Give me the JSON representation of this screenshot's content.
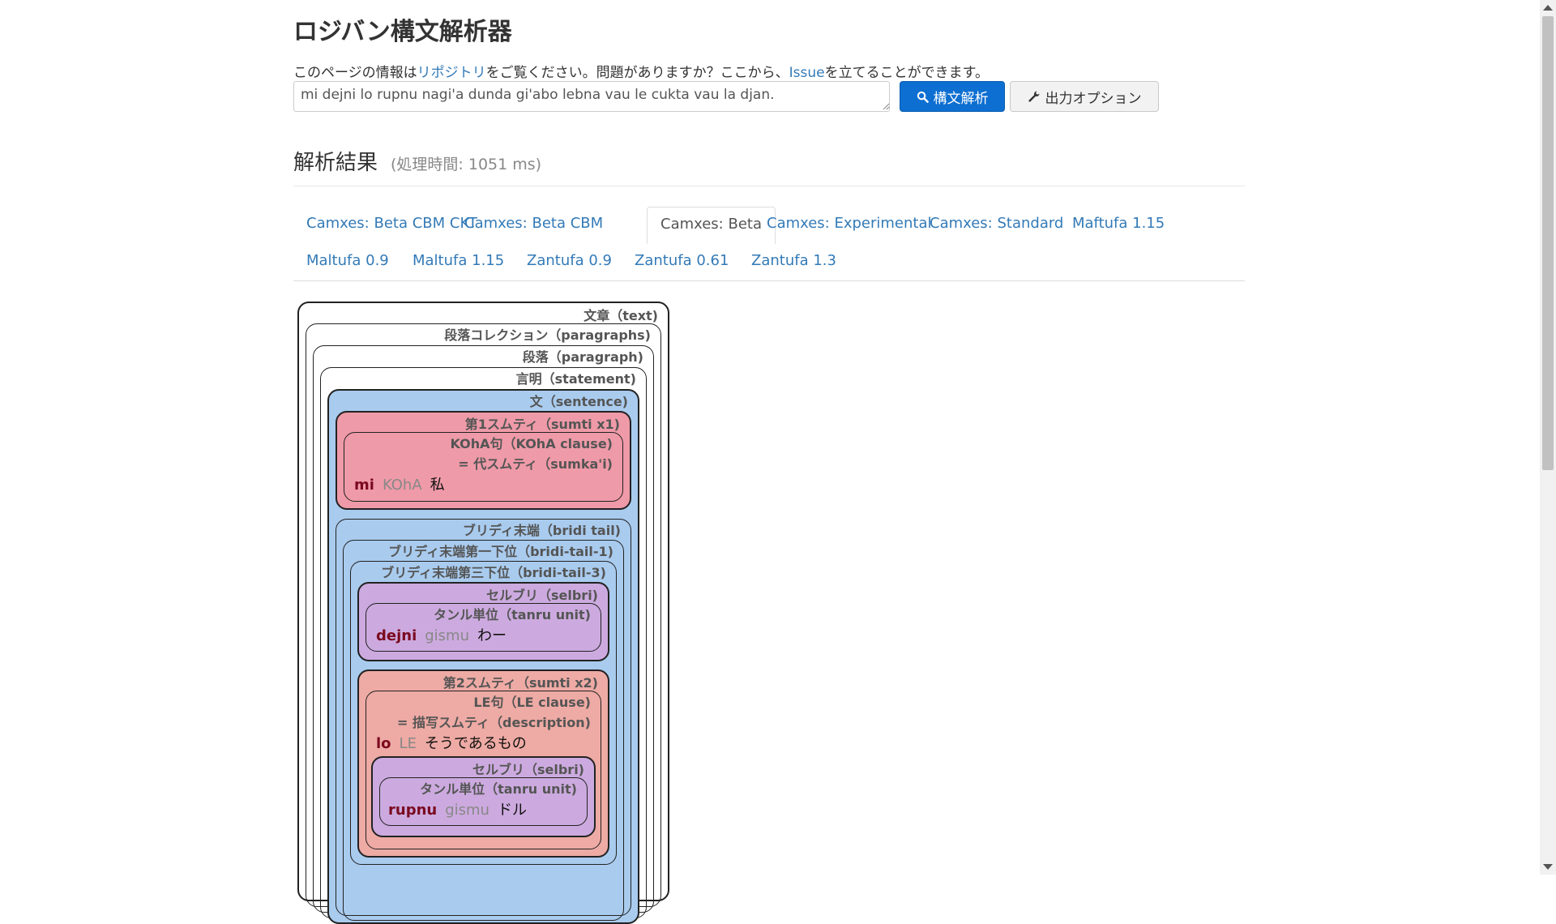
{
  "header": {
    "title": "ロジバン構文解析器",
    "intro_prefix": "このページの情報は",
    "intro_link1": "リポジトリ",
    "intro_mid": "をご覧ください。問題がありますか？ここから、",
    "intro_link2": "Issue",
    "intro_suffix": "を立てることができます。"
  },
  "form": {
    "input_value": "mi dejni lo rupnu nagi'a dunda gi'abo lebna vau le cukta vau la djan.",
    "parse_button": "構文解析",
    "options_button": "出力オプション"
  },
  "results": {
    "title": "解析結果",
    "time": "(処理時間: 1051 ms)"
  },
  "tabs": [
    {
      "label": "Camxes: Beta CBM CKT"
    },
    {
      "label": "Camxes: Beta CBM"
    },
    {
      "label": "Camxes: Beta",
      "active": true
    },
    {
      "label": "Camxes: Experimental"
    },
    {
      "label": "Camxes: Standard"
    },
    {
      "label": "Maftufa 1.15"
    },
    {
      "label": "Maltufa 0.9"
    },
    {
      "label": "Maltufa 1.15"
    },
    {
      "label": "Zantufa 0.9"
    },
    {
      "label": "Zantufa 0.61"
    },
    {
      "label": "Zantufa 1.3"
    }
  ],
  "tree": {
    "text": "文章（text)",
    "paragraphs": "段落コレクション（paragraphs)",
    "paragraph": "段落（paragraph)",
    "statement": "言明（statement)",
    "sentence": "文（sentence)",
    "sumti_x1": "第1スムティ（sumti x1)",
    "koha_clause": "KOhA句（KOhA clause)",
    "sumkai": "= 代スムティ（sumka'i)",
    "mi": {
      "word": "mi",
      "class": "KOhA",
      "gloss": "私"
    },
    "bridi_tail": "ブリディ末端（bridi tail)",
    "bridi_tail_1": "ブリディ末端第一下位（bridi-tail-1)",
    "bridi_tail_3": "ブリディ末端第三下位（bridi-tail-3)",
    "selbri": "セルブリ（selbri)",
    "tanru_unit": "タンル単位（tanru unit)",
    "dejni": {
      "word": "dejni",
      "class": "gismu",
      "gloss": "わー"
    },
    "sumti_x2": "第2スムティ（sumti x2)",
    "le_clause": "LE句（LE clause)",
    "description": "= 描写スムティ（description)",
    "lo": {
      "word": "lo",
      "class": "LE",
      "gloss": "そうであるもの"
    },
    "selbri2": "セルブリ（selbri)",
    "tanru_unit2": "タンル単位（tanru unit)",
    "rupnu": {
      "word": "rupnu",
      "class": "gismu",
      "gloss": "ドル"
    }
  },
  "colors": {
    "sentence_bg": "#a9cbee",
    "sumti_x1_bg": "#ef9aa8",
    "selbri_bg": "#ccaadf",
    "sumti_x2_bg": "#eeaaa4",
    "link": "#337ab7",
    "primary_button": "#0d6fd1"
  }
}
